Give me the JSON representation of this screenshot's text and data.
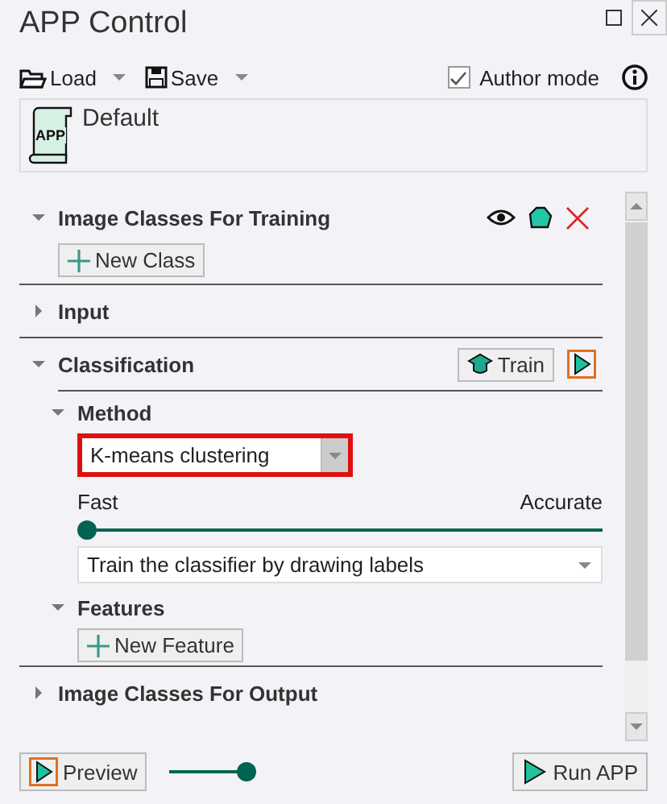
{
  "window": {
    "title": "APP Control"
  },
  "toolbar": {
    "load": "Load",
    "save": "Save",
    "author_mode": {
      "label": "Author mode",
      "checked": true
    }
  },
  "app": {
    "icon_text": "APP",
    "name": "Default"
  },
  "sections": [
    {
      "kind": "classes",
      "title": "Image Classes For Training",
      "expanded": true,
      "button": "New Class"
    },
    {
      "kind": "plain",
      "title": "Input",
      "expanded": false
    },
    {
      "kind": "classification",
      "title": "Classification",
      "expanded": true,
      "train": "Train",
      "subsections": [
        {
          "kind": "method",
          "title": "Method",
          "expanded": true,
          "method": "K-means clustering",
          "highlighted": true,
          "slider_min": "Fast",
          "slider_max": "Accurate",
          "level": 0,
          "mode": "Train the classifier by drawing labels"
        },
        {
          "kind": "features",
          "title": "Features",
          "expanded": true,
          "button": "New Feature"
        }
      ]
    },
    {
      "kind": "plain",
      "title": "Image Classes For Output",
      "expanded": false
    }
  ],
  "footer": {
    "preview": "Preview",
    "level": 1,
    "run": "Run APP"
  }
}
